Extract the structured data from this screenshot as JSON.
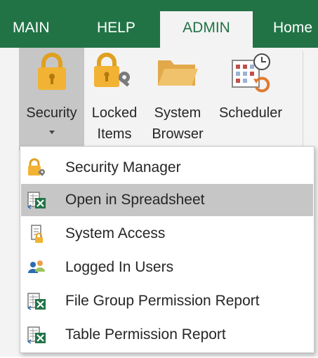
{
  "tabs": {
    "main": "MAIN",
    "help": "HELP",
    "admin": "ADMIN",
    "home": "Home"
  },
  "ribbon": {
    "security": {
      "label": "Security",
      "icon": "padlock-icon"
    },
    "locked_items": {
      "label1": "Locked",
      "label2": "Items",
      "icon": "lock-key-icon"
    },
    "system_browser": {
      "label1": "System",
      "label2": "Browser",
      "icon": "folder-icon"
    },
    "scheduler": {
      "label": "Scheduler",
      "icon": "calendar-clock-icon"
    }
  },
  "security_menu": {
    "items": [
      {
        "label": "Security Manager",
        "icon": "lock-key-icon"
      },
      {
        "label": "Open in Spreadsheet",
        "icon": "excel-sheet-icon"
      },
      {
        "label": "System Access",
        "icon": "document-lock-icon"
      },
      {
        "label": "Logged In Users",
        "icon": "users-icon"
      },
      {
        "label": "File Group Permission Report",
        "icon": "excel-sheet-icon"
      },
      {
        "label": "Table Permission Report",
        "icon": "excel-sheet-icon"
      }
    ]
  },
  "colors": {
    "brand_green": "#217346",
    "hover_gray": "#c6c6c6",
    "lock_gold": "#f2b233",
    "folder_tan": "#f0c26b"
  }
}
